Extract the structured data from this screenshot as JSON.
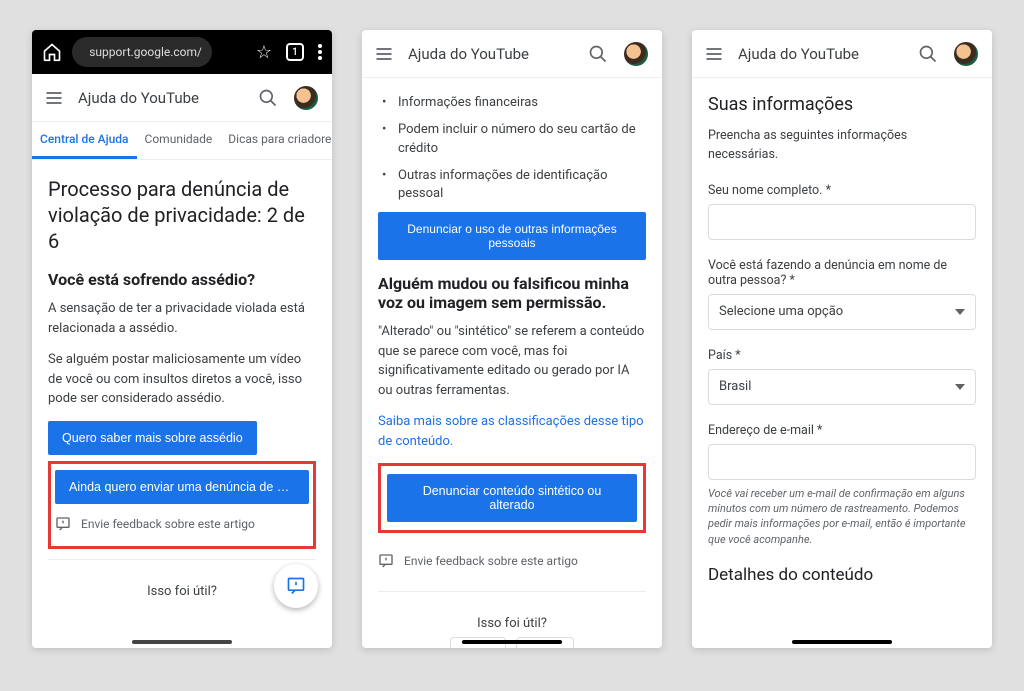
{
  "browser": {
    "url": "support.google.com/",
    "tab_count": "1"
  },
  "header": {
    "title": "Ajuda do YouTube"
  },
  "tabs": {
    "help_center": "Central de Ajuda",
    "community": "Comunidade",
    "tips": "Dicas para criadores de co"
  },
  "screen1": {
    "heading": "Processo para denúncia de violação de privacidade: 2 de 6",
    "subheading": "Você está sofrendo assédio?",
    "p1": "A sensação de ter a privacidade violada está relacionada a assédio.",
    "p2": "Se alguém postar maliciosamente um vídeo de você ou com insultos diretos a você, isso pode ser considerado assédio.",
    "btn_more": "Quero saber mais sobre assédio",
    "btn_continue": "Ainda quero enviar uma denúncia de violação de priv",
    "feedback": "Envie feedback sobre este artigo",
    "useful": "Isso foi útil?"
  },
  "screen2": {
    "bullet1": "Informações financeiras",
    "bullet2": "Podem incluir o número do seu cartão de crédito",
    "bullet3": "Outras informações de identificação pessoal",
    "btn_report_personal": "Denunciar o uso de outras informações pessoais",
    "subheading": "Alguém mudou ou falsificou minha voz ou imagem sem permissão.",
    "p1": "\"Alterado\" ou \"sintético\" se referem a conteúdo que se parece com você, mas foi significativamente editado ou gerado por IA ou outras ferramentas.",
    "link": "Saiba mais sobre as classificações desse tipo de conteúdo.",
    "btn_report_synthetic": "Denunciar conteúdo sintético ou alterado",
    "feedback": "Envie feedback sobre este artigo",
    "useful": "Isso foi útil?",
    "yes": "Sim",
    "no": "Não"
  },
  "screen3": {
    "heading": "Suas informações",
    "intro": "Preencha as seguintes informações necessárias.",
    "label_name": "Seu nome completo. *",
    "label_behalf": "Você está fazendo a denúncia em nome de outra pessoa? *",
    "select_placeholder": "Selecione uma opção",
    "label_country": "País *",
    "country_value": "Brasil",
    "label_email": "Endereço de e-mail *",
    "hint": "Você vai receber um e-mail de confirmação em alguns minutos com um número de rastreamento. Podemos pedir mais informações por e-mail, então é importante que você acompanhe.",
    "details_heading": "Detalhes do conteúdo"
  }
}
